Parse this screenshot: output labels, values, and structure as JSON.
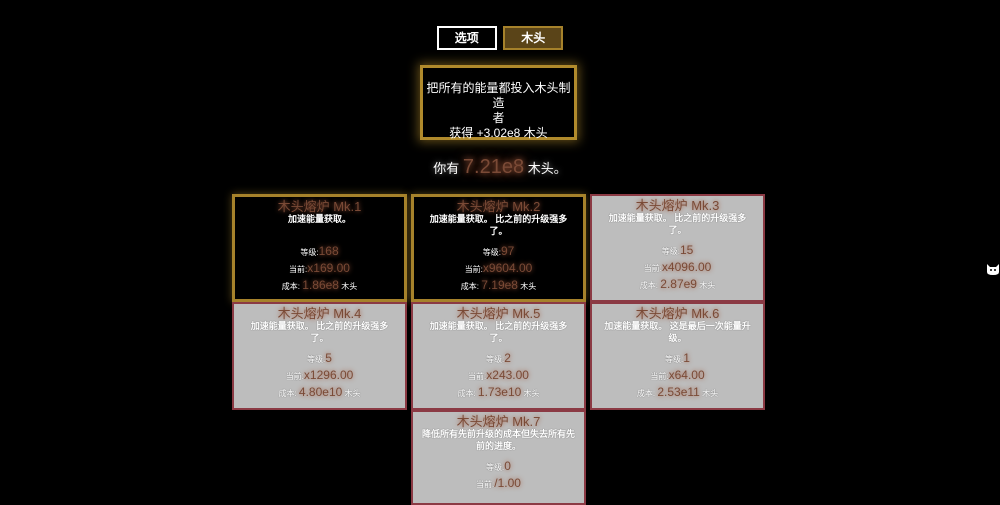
{
  "tabs": {
    "options": "选项",
    "wood": "木头"
  },
  "invest": {
    "line1": "把所有的能量都投入木头制造",
    "line2": "者",
    "line3": "获得 +3.02e8 木头"
  },
  "resource": {
    "prefix": "你有",
    "amount": "7.21e8",
    "suffix": "木头。"
  },
  "upgrades": [
    {
      "title": "木头熔炉 Mk.1",
      "desc": "加速能量获取。",
      "level_label": "等级:",
      "level": "168",
      "current_label": "当前:",
      "current": "x169.00",
      "cost_label": "成本:",
      "cost": "1.86e8",
      "cost_unit": "木头",
      "affordable": true
    },
    {
      "title": "木头熔炉 Mk.2",
      "desc": "加速能量获取。 比之前的升级强多了。",
      "level_label": "等级:",
      "level": "97",
      "current_label": "当前:",
      "current": "x9604.00",
      "cost_label": "成本:",
      "cost": "7.19e8",
      "cost_unit": "木头",
      "affordable": true
    },
    {
      "title": "木头熔炉 Mk.3",
      "desc": "加速能量获取。 比之前的升级强多了。",
      "level_label": "等级:",
      "level": "15",
      "current_label": "当前:",
      "current": "x4096.00",
      "cost_label": "成本:",
      "cost": "2.87e9",
      "cost_unit": "木头",
      "affordable": false
    },
    {
      "title": "木头熔炉 Mk.4",
      "desc": "加速能量获取。 比之前的升级强多了。",
      "level_label": "等级:",
      "level": "5",
      "current_label": "当前:",
      "current": "x1296.00",
      "cost_label": "成本:",
      "cost": "4.80e10",
      "cost_unit": "木头",
      "affordable": false
    },
    {
      "title": "木头熔炉 Mk.5",
      "desc": "加速能量获取。 比之前的升级强多了。",
      "level_label": "等级:",
      "level": "2",
      "current_label": "当前:",
      "current": "x243.00",
      "cost_label": "成本:",
      "cost": "1.73e10",
      "cost_unit": "木头",
      "affordable": false
    },
    {
      "title": "木头熔炉 Mk.6",
      "desc": "加速能量获取。 这是最后一次能量升级。",
      "level_label": "等级:",
      "level": "1",
      "current_label": "当前:",
      "current": "x64.00",
      "cost_label": "成本:",
      "cost": "2.53e11",
      "cost_unit": "木头",
      "affordable": false
    },
    {
      "title": "木头熔炉 Mk.7",
      "desc": "降低所有先前升级的成本但失去所有先前的进度。",
      "level_label": "等级:",
      "level": "0",
      "current_label": "当前:",
      "current": "/1.00",
      "cost_label": "",
      "cost": "",
      "cost_unit": "",
      "affordable": false
    }
  ],
  "side_icon": "cat-face-icon"
}
